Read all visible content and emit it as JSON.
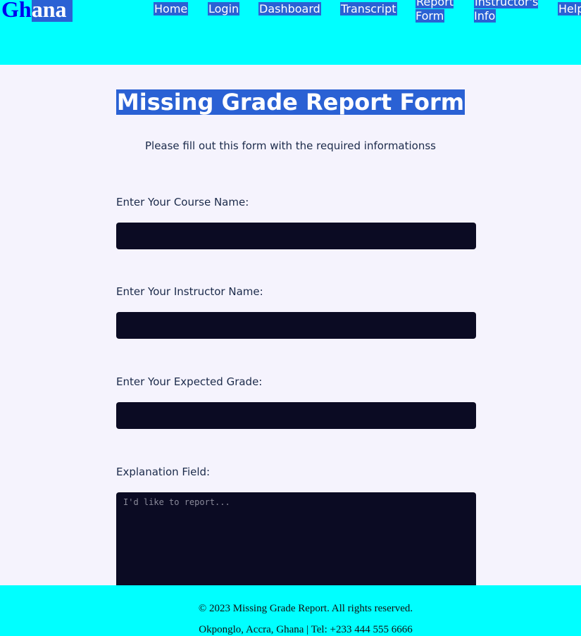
{
  "header": {
    "logo_part1": "Gh",
    "logo_part2": "ana",
    "nav": [
      {
        "label": "Home"
      },
      {
        "label": "Login"
      },
      {
        "label": "Dashboard"
      },
      {
        "label": "Transcript"
      },
      {
        "label": "Report Form"
      },
      {
        "label": "Instructor's Info"
      },
      {
        "label": "Help"
      }
    ]
  },
  "main": {
    "title": "Missing Grade Report Form",
    "subtitle": "Please fill out this form with the required informationss",
    "fields": [
      {
        "label": "Enter Your Course Name:",
        "value": ""
      },
      {
        "label": "Enter Your Instructor Name:",
        "value": ""
      },
      {
        "label": "Enter Your Expected Grade:",
        "value": ""
      }
    ],
    "explanation": {
      "label": "Explanation Field:",
      "placeholder": "I'd like to report...",
      "value": ""
    }
  },
  "footer": {
    "copyright": "© 2023 Missing Grade Report. All rights reserved.",
    "contact": "Okponglo, Accra, Ghana | Tel: +233 444 555 6666"
  },
  "colors": {
    "header_bg": "#00ffff",
    "highlight_bg": "#2a61d4",
    "page_bg": "#f5f3fd",
    "input_bg": "#0b0b23",
    "logo_blue": "#0000ee"
  }
}
